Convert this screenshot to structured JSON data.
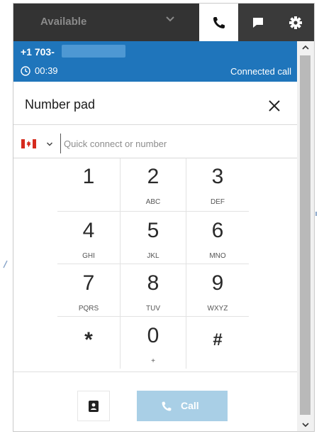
{
  "topbar": {
    "status_label": "Available",
    "tabs": [
      {
        "name": "phone",
        "icon": "phone-icon",
        "active": true
      },
      {
        "name": "chat",
        "icon": "chat-icon",
        "active": false
      },
      {
        "name": "settings",
        "icon": "gear-icon",
        "active": false
      }
    ]
  },
  "call": {
    "number_prefix": "+1 703-",
    "duration": "00:39",
    "state": "Connected call"
  },
  "number_pad": {
    "title": "Number pad",
    "country_flag": "canada-flag-icon",
    "input_placeholder": "Quick connect or number",
    "input_value": "",
    "keys": [
      {
        "digit": "1",
        "letters": ""
      },
      {
        "digit": "2",
        "letters": "ABC"
      },
      {
        "digit": "3",
        "letters": "DEF"
      },
      {
        "digit": "4",
        "letters": "GHI"
      },
      {
        "digit": "5",
        "letters": "JKL"
      },
      {
        "digit": "6",
        "letters": "MNO"
      },
      {
        "digit": "7",
        "letters": "PQRS"
      },
      {
        "digit": "8",
        "letters": "TUV"
      },
      {
        "digit": "9",
        "letters": "WXYZ"
      },
      {
        "digit": "*",
        "letters": ""
      },
      {
        "digit": "0",
        "letters": "+"
      },
      {
        "digit": "#",
        "letters": ""
      }
    ]
  },
  "actions": {
    "quick_connects_icon": "address-book-icon",
    "call_label": "Call"
  },
  "colors": {
    "banner": "#1f75bb",
    "topbar": "#333333",
    "call_button": "#a9cfe6",
    "flag_red": "#d52b1e"
  }
}
